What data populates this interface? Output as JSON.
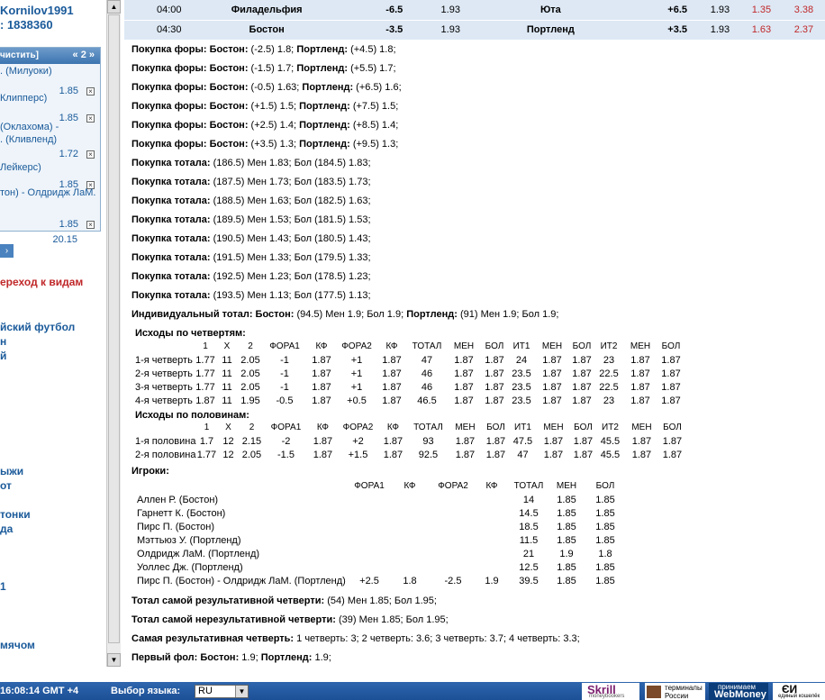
{
  "left": {
    "user_name": "Kornilov1991",
    "user_account": ": 1838360",
    "coupon_clear": "чистить]",
    "coupon_page": "« 2 »",
    "bets": [
      {
        "team": ". (Милуоки)",
        "team2": "",
        "odds": "1.85"
      },
      {
        "team": "Клипперс)",
        "team2": "",
        "odds": "1.85"
      },
      {
        "team": "(Оклахома) -",
        "team2": ". (Кливленд)",
        "odds": "1.72"
      },
      {
        "team": "Лейкерс)",
        "team2": "",
        "odds": "1.85"
      },
      {
        "team": "тон) - Олдридж ЛаМ.",
        "team2": "",
        "odds": "1.85"
      }
    ],
    "coupon_total": "20.15",
    "coupon_btn": "›",
    "goto_link": "ереход к видам",
    "sports": [
      "йский футбол",
      "н",
      "й",
      "ыжи",
      "от",
      "тонки",
      "да",
      "1",
      "мячом"
    ]
  },
  "games": [
    {
      "time": "04:00",
      "team1": "Филадельфия",
      "h1": "-6.5",
      "k1": "1.93",
      "team2": "Юта",
      "h2": "+6.5",
      "k2": "1.93",
      "t1": "1.35",
      "t2": "3.38"
    },
    {
      "time": "04:30",
      "team1": "Бостон",
      "h1": "-3.5",
      "k1": "1.93",
      "team2": "Портленд",
      "h2": "+3.5",
      "k2": "1.93",
      "t1": "1.63",
      "t2": "2.37"
    }
  ],
  "lines": [
    {
      "label": "Покупка форы:",
      "parts": [
        [
          "Бостон:",
          " (-2.5) 1.8;"
        ],
        [
          "Портленд:",
          " (+4.5) 1.8;"
        ]
      ]
    },
    {
      "label": "Покупка форы:",
      "parts": [
        [
          "Бостон:",
          " (-1.5) 1.7;"
        ],
        [
          "Портленд:",
          " (+5.5) 1.7;"
        ]
      ]
    },
    {
      "label": "Покупка форы:",
      "parts": [
        [
          "Бостон:",
          " (-0.5) 1.63;"
        ],
        [
          "Портленд:",
          " (+6.5) 1.6;"
        ]
      ]
    },
    {
      "label": "Покупка форы:",
      "parts": [
        [
          "Бостон:",
          " (+1.5) 1.5;"
        ],
        [
          "Портленд:",
          " (+7.5) 1.5;"
        ]
      ]
    },
    {
      "label": "Покупка форы:",
      "parts": [
        [
          "Бостон:",
          " (+2.5) 1.4;"
        ],
        [
          "Портленд:",
          " (+8.5) 1.4;"
        ]
      ]
    },
    {
      "label": "Покупка форы:",
      "parts": [
        [
          "Бостон:",
          " (+3.5) 1.3;"
        ],
        [
          "Портленд:",
          " (+9.5) 1.3;"
        ]
      ]
    },
    {
      "label": "Покупка тотала:",
      "text": " (186.5) Мен 1.83; Бол (184.5) 1.83;"
    },
    {
      "label": "Покупка тотала:",
      "text": " (187.5) Мен 1.73; Бол (183.5) 1.73;"
    },
    {
      "label": "Покупка тотала:",
      "text": " (188.5) Мен 1.63; Бол (182.5) 1.63;"
    },
    {
      "label": "Покупка тотала:",
      "text": " (189.5) Мен 1.53; Бол (181.5) 1.53;"
    },
    {
      "label": "Покупка тотала:",
      "text": " (190.5) Мен 1.43; Бол (180.5) 1.43;"
    },
    {
      "label": "Покупка тотала:",
      "text": " (191.5) Мен 1.33; Бол (179.5) 1.33;"
    },
    {
      "label": "Покупка тотала:",
      "text": " (192.5) Мен 1.23; Бол (178.5) 1.23;"
    },
    {
      "label": "Покупка тотала:",
      "text": " (193.5) Мен 1.13; Бол (177.5) 1.13;"
    },
    {
      "label": "Индивидуальный тотал:",
      "parts": [
        [
          "Бостон:",
          " (94.5) Мен 1.9; Бол 1.9;"
        ],
        [
          "Портленд:",
          " (91) Мен 1.9; Бол 1.9;"
        ]
      ]
    }
  ],
  "quarters": {
    "title": "Исходы по четвертям:",
    "headers": [
      "",
      "1",
      "X",
      "2",
      "ФОРА1",
      "КФ",
      "ФОРА2",
      "КФ",
      "ТОТАЛ",
      "МЕН",
      "БОЛ",
      "ИТ1",
      "МЕН",
      "БОЛ",
      "ИТ2",
      "МЕН",
      "БОЛ"
    ],
    "rows": [
      [
        "1-я четверть",
        "1.77",
        "11",
        "2.05",
        "-1",
        "1.87",
        "+1",
        "1.87",
        "47",
        "1.87",
        "1.87",
        "24",
        "1.87",
        "1.87",
        "23",
        "1.87",
        "1.87"
      ],
      [
        "2-я четверть",
        "1.77",
        "11",
        "2.05",
        "-1",
        "1.87",
        "+1",
        "1.87",
        "46",
        "1.87",
        "1.87",
        "23.5",
        "1.87",
        "1.87",
        "22.5",
        "1.87",
        "1.87"
      ],
      [
        "3-я четверть",
        "1.77",
        "11",
        "2.05",
        "-1",
        "1.87",
        "+1",
        "1.87",
        "46",
        "1.87",
        "1.87",
        "23.5",
        "1.87",
        "1.87",
        "22.5",
        "1.87",
        "1.87"
      ],
      [
        "4-я четверть",
        "1.87",
        "11",
        "1.95",
        "-0.5",
        "1.87",
        "+0.5",
        "1.87",
        "46.5",
        "1.87",
        "1.87",
        "23.5",
        "1.87",
        "1.87",
        "23",
        "1.87",
        "1.87"
      ]
    ]
  },
  "halves": {
    "title": "Исходы по половинам:",
    "headers": [
      "",
      "1",
      "X",
      "2",
      "ФОРА1",
      "КФ",
      "ФОРА2",
      "КФ",
      "ТОТАЛ",
      "МЕН",
      "БОЛ",
      "ИТ1",
      "МЕН",
      "БОЛ",
      "ИТ2",
      "МЕН",
      "БОЛ"
    ],
    "rows": [
      [
        "1-я половина",
        "1.7",
        "12",
        "2.15",
        "-2",
        "1.87",
        "+2",
        "1.87",
        "93",
        "1.87",
        "1.87",
        "47.5",
        "1.87",
        "1.87",
        "45.5",
        "1.87",
        "1.87"
      ],
      [
        "2-я половина",
        "1.77",
        "12",
        "2.05",
        "-1.5",
        "1.87",
        "+1.5",
        "1.87",
        "92.5",
        "1.87",
        "1.87",
        "47",
        "1.87",
        "1.87",
        "45.5",
        "1.87",
        "1.87"
      ]
    ]
  },
  "players": {
    "title": "Игроки:",
    "headers": [
      "",
      "ФОРА1",
      "КФ",
      "ФОРА2",
      "КФ",
      "ТОТАЛ",
      "МЕН",
      "БОЛ"
    ],
    "rows": [
      [
        "Аллен Р. (Бостон)",
        "",
        "",
        "",
        "",
        "14",
        "1.85",
        "1.85"
      ],
      [
        "Гарнетт К. (Бостон)",
        "",
        "",
        "",
        "",
        "14.5",
        "1.85",
        "1.85"
      ],
      [
        "Пирс П. (Бостон)",
        "",
        "",
        "",
        "",
        "18.5",
        "1.85",
        "1.85"
      ],
      [
        "Мэттьюз У. (Портленд)",
        "",
        "",
        "",
        "",
        "11.5",
        "1.85",
        "1.85"
      ],
      [
        "Олдридж ЛаМ. (Портленд)",
        "",
        "",
        "",
        "",
        "21",
        "1.9",
        "1.8"
      ],
      [
        "Уоллес Дж. (Портленд)",
        "",
        "",
        "",
        "",
        "12.5",
        "1.85",
        "1.85"
      ],
      [
        "Пирс П. (Бостон) - Олдридж ЛаМ. (Портленд)",
        "+2.5",
        "1.8",
        "-2.5",
        "1.9",
        "39.5",
        "1.85",
        "1.85"
      ]
    ]
  },
  "bottom_lines": [
    {
      "label": "Тотал самой результативной четверти:",
      "text": " (54) Мен 1.85; Бол 1.95;"
    },
    {
      "label": "Тотал самой нерезультативной четверти:",
      "text": " (39) Мен 1.85; Бол 1.95;"
    },
    {
      "label": "Самая результативная четверть:",
      "text": " 1 четверть: 3; 2 четверть: 3.6; 3 четверть: 3.7; 4 четверть: 3.3;"
    },
    {
      "label": "Первый фол:",
      "parts": [
        [
          "Бостон:",
          " 1.9;"
        ],
        [
          "Портленд:",
          " 1.9;"
        ]
      ]
    }
  ],
  "footer": {
    "time": "16:08:14  GMT +4",
    "lang_label": "Выбор языка:",
    "lang_value": "RU",
    "skrill": "Skrill",
    "skrill_sub": "moneybookers",
    "term1": "терминалы",
    "term2": "России",
    "wm1": "принимаем",
    "wm2": "WebMoney",
    "cent1": "ЄИ",
    "cent2": "единый кошелёк"
  },
  "colors": {
    "accent": "#1a5a9a",
    "red": "#c0282a",
    "row_bg": "#dde8f4",
    "footer": "#2461a8"
  }
}
